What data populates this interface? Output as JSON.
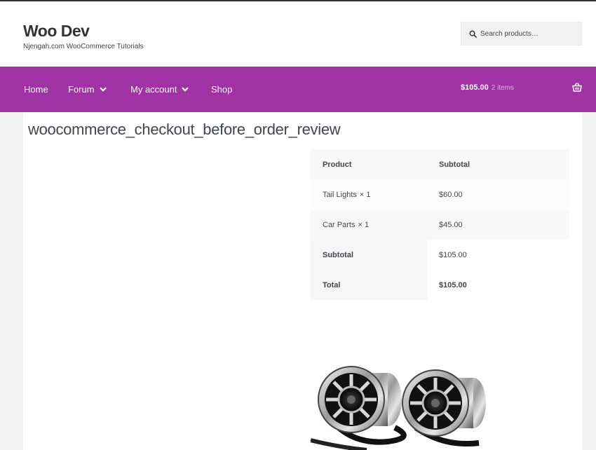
{
  "site": {
    "title": "Woo Dev",
    "description": "Njengah.com WooCommerce Tutorials"
  },
  "search": {
    "placeholder": "Search products…",
    "icon": "search-icon"
  },
  "nav": {
    "items": [
      {
        "label": "Home",
        "has_dropdown": false
      },
      {
        "label": "Forum",
        "has_dropdown": true
      },
      {
        "label": "My account",
        "has_dropdown": true
      },
      {
        "label": "Shop",
        "has_dropdown": false
      }
    ]
  },
  "cart": {
    "total": "$105.00",
    "count": "2 items",
    "icon": "basket-icon"
  },
  "page": {
    "title": "woocommerce_checkout_before_order_review"
  },
  "order_review": {
    "headers": {
      "product": "Product",
      "subtotal": "Subtotal"
    },
    "items": [
      {
        "name": "Tail Lights",
        "qty": "× 1",
        "subtotal": "$60.00"
      },
      {
        "name": "Car Parts",
        "qty": "× 1",
        "subtotal": "$45.00"
      }
    ],
    "subtotal_label": "Subtotal",
    "subtotal_value": "$105.00",
    "total_label": "Total",
    "total_value": "$105.00"
  },
  "product_image": {
    "icon": "speakers-product-image"
  },
  "colors": {
    "accent": "#a033a3",
    "header_bg": "#ffffff",
    "page_bg": "#f2f2f2",
    "text": "#43454b"
  }
}
